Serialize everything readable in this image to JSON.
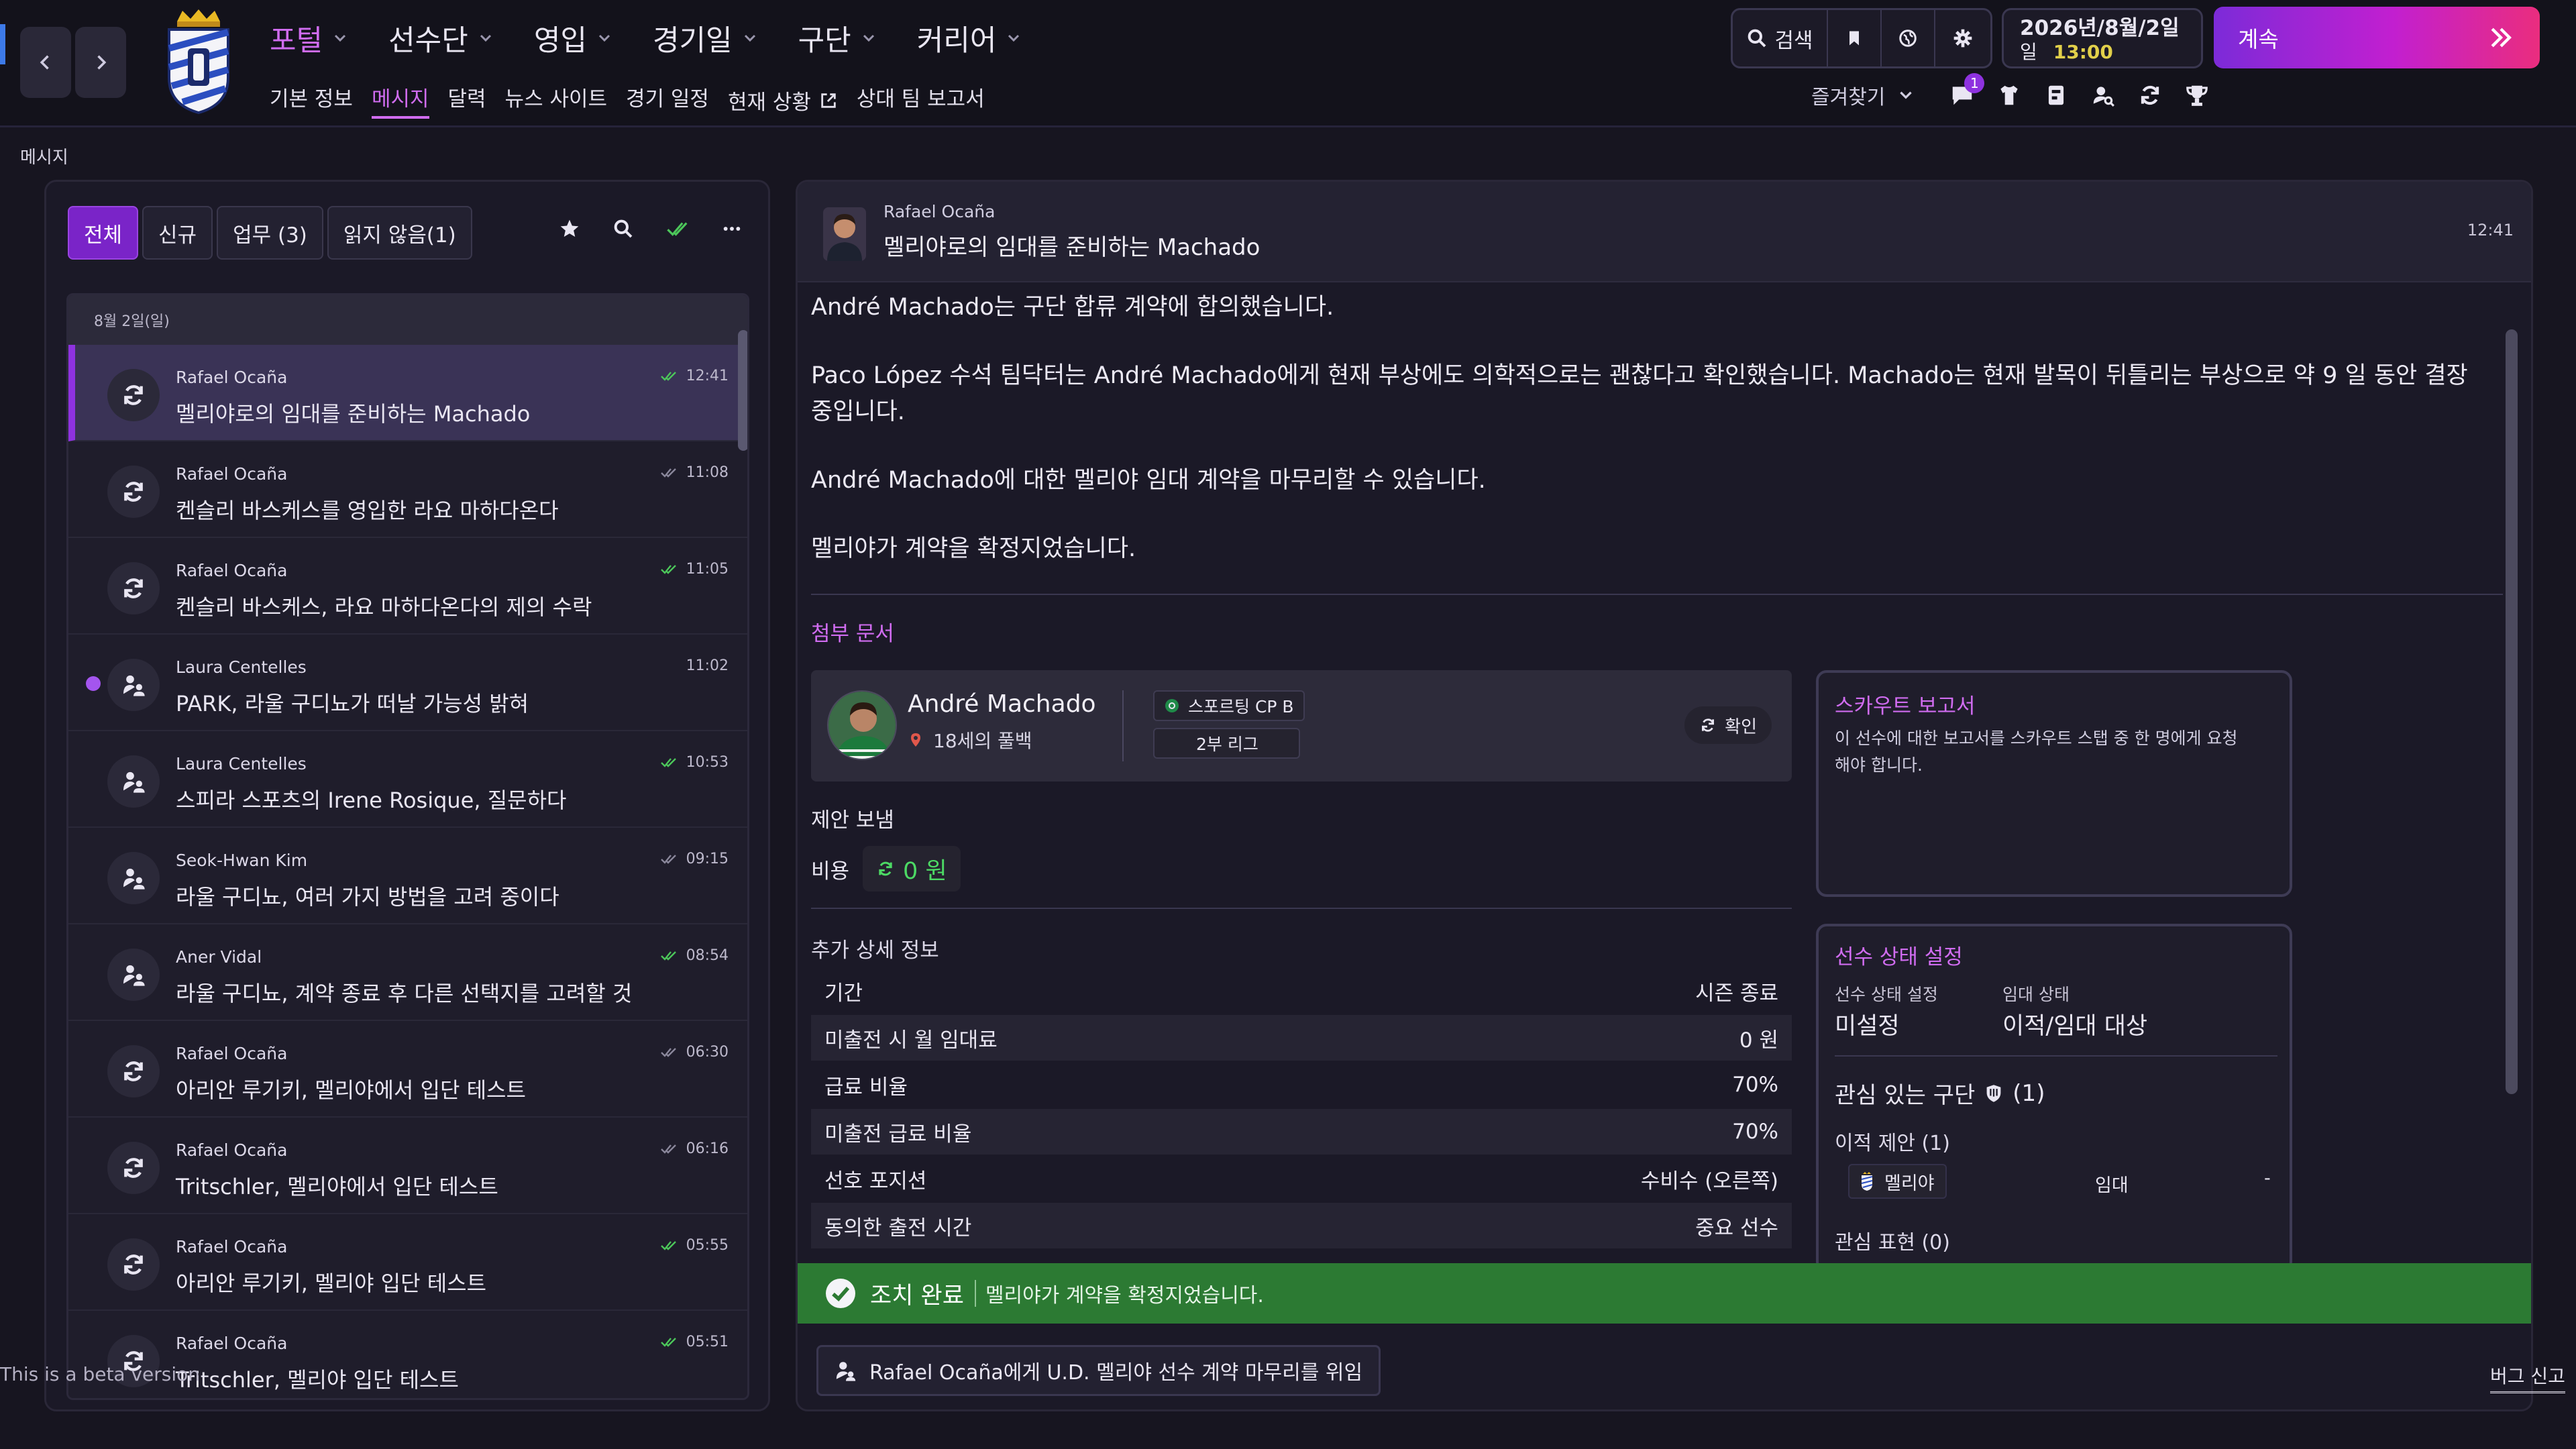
{
  "topbar": {
    "main_menu": [
      {
        "label": "포털",
        "active": true
      },
      {
        "label": "선수단",
        "active": false
      },
      {
        "label": "영입",
        "active": false
      },
      {
        "label": "경기일",
        "active": false
      },
      {
        "label": "구단",
        "active": false
      },
      {
        "label": "커리어",
        "active": false
      }
    ],
    "sub_menu": [
      {
        "label": "기본 정보",
        "active": false
      },
      {
        "label": "메시지",
        "active": true
      },
      {
        "label": "달력",
        "active": false
      },
      {
        "label": "뉴스 사이트",
        "active": false
      },
      {
        "label": "경기 일정",
        "active": false
      },
      {
        "label": "현재 상황",
        "active": false
      },
      {
        "label": "상대 팀 보고서",
        "active": false
      }
    ],
    "search_label": "검색",
    "date_line1": "2026년/8월/2일",
    "date_line2": "일",
    "time": "13:00",
    "continue_label": "계속",
    "favorites_label": "즐겨찾기",
    "chat_badge": "1"
  },
  "page_label": "메시지",
  "inbox": {
    "tabs": [
      {
        "label": "전체",
        "active": true
      },
      {
        "label": "신규",
        "active": false
      },
      {
        "label": "업무 (3)",
        "active": false
      },
      {
        "label": "읽지 않음(1)",
        "active": false
      }
    ],
    "date_group": "8월 2일(일)",
    "messages": [
      {
        "sender": "Rafael Ocaña",
        "subject": "멜리야로의 임대를 준비하는 Machado",
        "time": "12:41",
        "icon": "refresh-icon",
        "read_check": "double",
        "selected": true,
        "unread": false
      },
      {
        "sender": "Rafael Ocaña",
        "subject": "켄슬리 바스케스를 영입한 라요 마하다온다",
        "time": "11:08",
        "icon": "refresh-icon",
        "read_check": "double-dim",
        "selected": false,
        "unread": false
      },
      {
        "sender": "Rafael Ocaña",
        "subject": "켄슬리 바스케스, 라요 마하다온다의 제의 수락",
        "time": "11:05",
        "icon": "refresh-icon",
        "read_check": "double",
        "selected": false,
        "unread": false
      },
      {
        "sender": "Laura Centelles",
        "subject": "PARK, 라울 구디뇨가 떠날 가능성 밝혀",
        "time": "11:02",
        "icon": "people-icon",
        "read_check": "none",
        "selected": false,
        "unread": true
      },
      {
        "sender": "Laura Centelles",
        "subject": "스피라 스포츠의 Irene Rosique, 질문하다",
        "time": "10:53",
        "icon": "people-icon",
        "read_check": "double",
        "selected": false,
        "unread": false
      },
      {
        "sender": "Seok-Hwan Kim",
        "subject": "라울 구디뇨, 여러 가지 방법을 고려 중이다",
        "time": "09:15",
        "icon": "people-icon",
        "read_check": "double-dim",
        "selected": false,
        "unread": false
      },
      {
        "sender": "Aner Vidal",
        "subject": "라울 구디뇨, 계약 종료 후 다른 선택지를 고려할 것",
        "time": "08:54",
        "icon": "people-icon",
        "read_check": "double",
        "selected": false,
        "unread": false
      },
      {
        "sender": "Rafael Ocaña",
        "subject": "아리안 루기키, 멜리야에서 입단 테스트",
        "time": "06:30",
        "icon": "refresh-icon",
        "read_check": "double-dim",
        "selected": false,
        "unread": false
      },
      {
        "sender": "Rafael Ocaña",
        "subject": "Tritschler, 멜리야에서 입단 테스트",
        "time": "06:16",
        "icon": "refresh-icon",
        "read_check": "double-dim",
        "selected": false,
        "unread": false
      },
      {
        "sender": "Rafael Ocaña",
        "subject": "아리안 루기키, 멜리야 입단 테스트",
        "time": "05:55",
        "icon": "refresh-icon",
        "read_check": "double",
        "selected": false,
        "unread": false
      },
      {
        "sender": "Rafael Ocaña",
        "subject": "Tritschler, 멜리야 입단 테스트",
        "time": "05:51",
        "icon": "refresh-icon",
        "read_check": "double",
        "selected": false,
        "unread": false
      }
    ]
  },
  "message": {
    "sender": "Rafael Ocaña",
    "subject": "멜리야로의 임대를 준비하는 Machado",
    "time": "12:41",
    "paragraphs": [
      "André Machado는 구단 합류 계약에 합의했습니다.",
      "Paco López 수석 팀닥터는 André Machado에게 현재 부상에도 의학적으로는 괜찮다고 확인했습니다. Machado는 현재 발목이 뒤틀리는 부상으로 약 9 일 동안 결장 중입니다.",
      "André Machado에 대한 멜리야 임대 계약을 마무리할 수 있습니다.",
      "멜리야가 계약을 확정지었습니다."
    ],
    "attachments_label": "첨부 문서",
    "player": {
      "name": "André Machado",
      "desc": "18세의 풀백",
      "club": "스포르팅 CP B",
      "league": "2부 리그",
      "view_label": "확인"
    },
    "offer_label": "제안 보냄",
    "fee_label": "비용",
    "fee_value": "0 원",
    "details_label": "추가 상세 정보",
    "details": [
      {
        "k": "기간",
        "v": "시즌 종료"
      },
      {
        "k": "미출전 시 월 임대료",
        "v": "0 원"
      },
      {
        "k": "급료 비율",
        "v": "70%"
      },
      {
        "k": "미출전 급료 비율",
        "v": "70%"
      },
      {
        "k": "선호 포지션",
        "v": "수비수 (오른쪽)"
      },
      {
        "k": "동의한 출전 시간",
        "v": "중요 선수"
      }
    ],
    "scout": {
      "title": "스카우트 보고서",
      "text": "이 선수에 대한 보고서를 스카우트 스탭 중 한 명에게 요청해야 합니다."
    },
    "status": {
      "title": "선수 상태 설정",
      "player_status_label": "선수 상태 설정",
      "player_status_value": "미설정",
      "loan_status_label": "임대 상태",
      "loan_status_value": "이적/임대 대상",
      "interested_label": "관심 있는 구단",
      "interested_count": "(1)",
      "offers_label": "이적 제안 (1)",
      "offer_club": "멜리야",
      "offer_type": "임대",
      "offer_extra": "-",
      "interest_label": "관심 표현 (0)"
    },
    "done_title": "조치 완료",
    "done_text": "멜리야가 계약을 확정지었습니다.",
    "delegate_label": "Rafael Ocaña에게 U.D. 멜리야 선수 계약 마무리를 위임"
  },
  "footer": {
    "beta": "This is a beta version",
    "bug_report": "버그 신고"
  },
  "colors": {
    "accent": "#d06cf0",
    "selected_tab": "#7a24c8",
    "done_bar": "#2c7a33",
    "check_green": "#4cc65a",
    "fee_green": "#4cd964"
  }
}
